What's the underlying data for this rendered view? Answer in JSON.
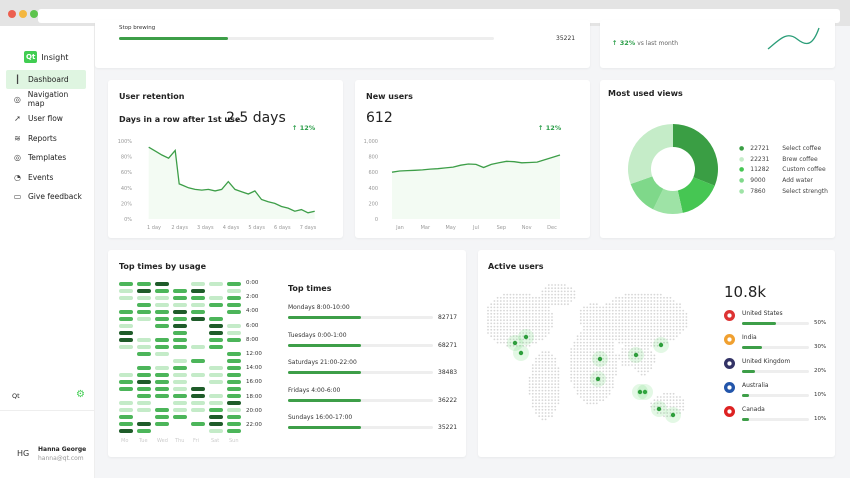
{
  "sidebar": {
    "logo_mark": "Qt",
    "logo_text": "Insight",
    "items": [
      {
        "label": "Dashboard",
        "icon": "chart-bar-icon"
      },
      {
        "label": "Navigation map",
        "icon": "compass-icon"
      },
      {
        "label": "User flow",
        "icon": "cursor-icon"
      },
      {
        "label": "Reports",
        "icon": "layers-icon"
      },
      {
        "label": "Templates",
        "icon": "compass-icon"
      },
      {
        "label": "Events",
        "icon": "rss-icon"
      },
      {
        "label": "Give feedback",
        "icon": "feedback-icon"
      }
    ],
    "org": "Qt",
    "user": {
      "initials": "HG",
      "name": "Hanna George",
      "email": "hanna@qt.com"
    }
  },
  "top_card": {
    "label": "Stop brewing",
    "value": "35221",
    "fill": 0.29
  },
  "trend_card": {
    "change": "32%",
    "text": "vs last month"
  },
  "retention": {
    "title": "User retention",
    "subtitle": "Days in a row after 1st use",
    "value": "2.5 days",
    "change": "12%",
    "y_ticks": [
      "100%",
      "80%",
      "60%",
      "40%",
      "20%",
      "0%"
    ],
    "x_ticks": [
      "1 day",
      "2 days",
      "3 days",
      "4 days",
      "5 days",
      "6 days",
      "7 days"
    ]
  },
  "new_users": {
    "title": "New users",
    "value": "612",
    "change": "12%",
    "y_ticks": [
      "1,000",
      "800",
      "600",
      "400",
      "200",
      "0"
    ],
    "x_ticks": [
      "Jan",
      "Mar",
      "May",
      "Jul",
      "Sep",
      "Nov",
      "Dec"
    ]
  },
  "views": {
    "title": "Most used views",
    "items": [
      {
        "value": "22721",
        "label": "Select coffee",
        "color": "#3a9e44"
      },
      {
        "value": "22231",
        "label": "Brew coffee",
        "color": "#c5ecc8"
      },
      {
        "value": "11282",
        "label": "Custom coffee",
        "color": "#46c653"
      },
      {
        "value": "9000",
        "label": "Add water",
        "color": "#7fd88a"
      },
      {
        "value": "7860",
        "label": "Select strength",
        "color": "#9ee3a6"
      }
    ]
  },
  "chart_data": [
    {
      "type": "line",
      "title": "User retention",
      "ylim": [
        0,
        100
      ],
      "x": [
        1,
        1.25,
        1.5,
        1.75,
        2,
        2.15,
        2.3,
        2.5,
        2.75,
        3,
        3.25,
        3.5,
        3.75,
        4,
        4.25,
        4.5,
        4.75,
        5,
        5.25,
        5.5,
        5.75,
        6,
        6.25,
        6.5,
        6.75,
        7,
        7.25
      ],
      "y": [
        92,
        87,
        82,
        78,
        88,
        45,
        43,
        40,
        38,
        37,
        38,
        36,
        38,
        48,
        38,
        35,
        32,
        36,
        25,
        22,
        20,
        16,
        14,
        10,
        12,
        8,
        10
      ]
    },
    {
      "type": "line",
      "title": "New users",
      "ylim": [
        0,
        1000
      ],
      "x": [
        0,
        1,
        2,
        3,
        4,
        5,
        6,
        7,
        8,
        9,
        10,
        11,
        12,
        13,
        14,
        15,
        16,
        17,
        18,
        19,
        20,
        21,
        22
      ],
      "y": [
        600,
        615,
        620,
        625,
        630,
        640,
        645,
        655,
        665,
        690,
        705,
        700,
        660,
        700,
        720,
        740,
        735,
        720,
        725,
        730,
        760,
        790,
        820
      ]
    },
    {
      "type": "pie",
      "title": "Most used views",
      "categories": [
        "Select coffee",
        "Brew coffee",
        "Custom coffee",
        "Add water",
        "Select strength"
      ],
      "values": [
        22721,
        22231,
        11282,
        9000,
        7860
      ]
    }
  ],
  "top_times": {
    "title": "Top times by usage",
    "list_title": "Top times",
    "hours": [
      "0:00",
      "2:00",
      "4:00",
      "6:00",
      "8:00",
      "12:00",
      "14:00",
      "16:00",
      "18:00",
      "20:00",
      "22:00"
    ],
    "days": [
      "Mo",
      "Tue",
      "Wed",
      "Thu",
      "Fri",
      "Sat",
      "Sun"
    ],
    "levels": [
      "2230112",
      "1322301",
      "1112212",
      "0211122",
      "2223202",
      "2122320",
      "1023031",
      "3002031",
      "3122022",
      "1122120",
      "0210002",
      "0001202",
      "0212012",
      "1221112",
      "2321012",
      "2221302",
      "0222312",
      "1101113",
      "1121121",
      "2022032",
      "2320232",
      "3200012"
    ],
    "items": [
      {
        "label": "Mondays 8:00-10:00",
        "value": "82717",
        "fill": 0.5
      },
      {
        "label": "Tuesdays 0:00-1:00",
        "value": "68271",
        "fill": 0.5
      },
      {
        "label": "Saturdays 21:00-22:00",
        "value": "38483",
        "fill": 0.5
      },
      {
        "label": "Fridays 4:00-6:00",
        "value": "36222",
        "fill": 0.5
      },
      {
        "label": "Sundays  16:00-17:00",
        "value": "35221",
        "fill": 0.5
      }
    ]
  },
  "active_users": {
    "title": "Active users",
    "total": "10.8k",
    "countries": [
      {
        "name": "United States",
        "pct": "50%",
        "fill": 0.5
      },
      {
        "name": "India",
        "pct": "30%",
        "fill": 0.3
      },
      {
        "name": "United Kingdom",
        "pct": "20%",
        "fill": 0.2
      },
      {
        "name": "Australia",
        "pct": "10%",
        "fill": 0.1
      },
      {
        "name": "Canada",
        "pct": "10%",
        "fill": 0.1
      }
    ]
  }
}
